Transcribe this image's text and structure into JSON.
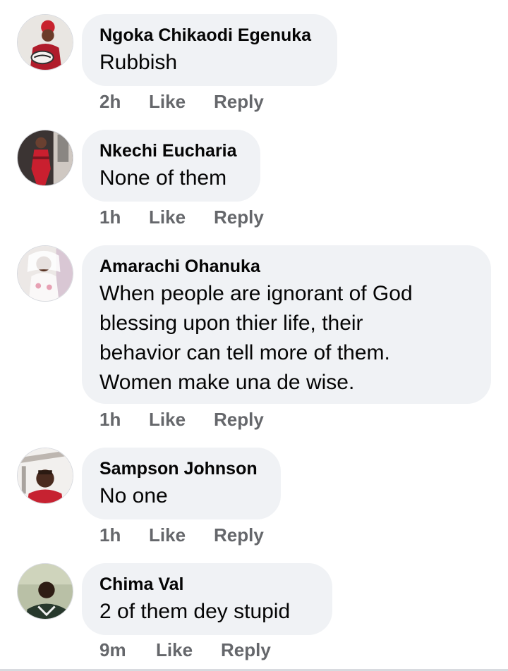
{
  "comments": [
    {
      "author": "Ngoka Chikaodi Egenuka",
      "text": "Rubbish",
      "time": "2h",
      "like_label": "Like",
      "reply_label": "Reply"
    },
    {
      "author": "Nkechi Eucharia",
      "text": "None of them",
      "time": "1h",
      "like_label": "Like",
      "reply_label": "Reply"
    },
    {
      "author": "Amarachi Ohanuka",
      "text": "When people are ignorant of God blessing upon thier life, their behavior can tell more of them. Women make una de wise.",
      "time": "1h",
      "like_label": "Like",
      "reply_label": "Reply"
    },
    {
      "author": "Sampson Johnson",
      "text": "No one",
      "time": "1h",
      "like_label": "Like",
      "reply_label": "Reply"
    },
    {
      "author": "Chima Val",
      "text": "2 of them dey stupid",
      "time": "9m",
      "like_label": "Like",
      "reply_label": "Reply"
    }
  ],
  "colors": {
    "bubble_bg": "#f0f2f5",
    "author_text": "#050505",
    "meta_text": "#65676b"
  }
}
